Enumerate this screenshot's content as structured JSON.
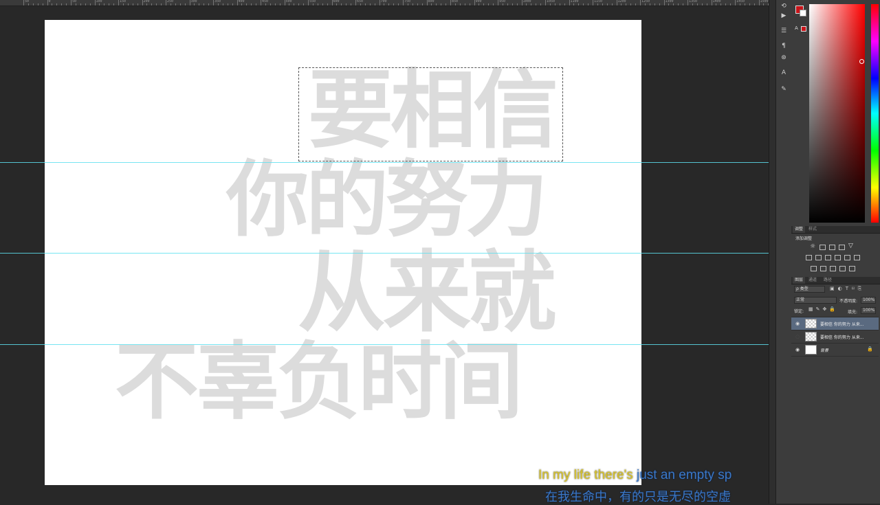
{
  "ruler": {
    "labels": [
      "50",
      "0",
      "50",
      "100",
      "150",
      "200",
      "250",
      "300",
      "350",
      "400",
      "450",
      "500",
      "550",
      "600",
      "650",
      "700",
      "750",
      "800",
      "850",
      "900",
      "950",
      "1000",
      "1050",
      "1100",
      "1150",
      "1200",
      "1250",
      "1300",
      "1350",
      "1400",
      "1450",
      "1500"
    ]
  },
  "canvas": {
    "lines": [
      "要相信",
      "你的努力",
      "从来就",
      "不辜负时间"
    ],
    "text_color": "#dcdcdc",
    "background": "#ffffff"
  },
  "subtitle": {
    "en_highlight": "In my life there's",
    "en_rest": " just an empty sp",
    "zh": "在我生命中，有的只是无尽的空虚"
  },
  "toolstrip": {
    "icons": [
      "history-icon",
      "play-icon",
      "sliders-icon",
      "paragraph-icon",
      "clone-source-icon",
      "character-icon",
      "brush-presets-icon"
    ]
  },
  "colors": {
    "foreground": "#c8141a",
    "background": "#ffffff"
  },
  "adjustments_panel": {
    "tabs": [
      "调整",
      "样式"
    ],
    "title": "添加调整"
  },
  "layers_panel": {
    "tabs": [
      "图层",
      "通道",
      "路径"
    ],
    "filter_label": "ρ 类型",
    "blend_mode": "正常",
    "opacity_label": "不透明度:",
    "opacity_value": "100%",
    "lock_label": "锁定:",
    "fill_label": "填充:",
    "fill_value": "100%",
    "layers": [
      {
        "name": "要相信 你的努力 从来...",
        "selected": true,
        "visible": true,
        "thumb": "check"
      },
      {
        "name": "要相信 你的努力 从来...",
        "selected": false,
        "visible": false,
        "thumb": "check"
      },
      {
        "name": "背景",
        "selected": false,
        "visible": true,
        "thumb": "white",
        "locked": true
      }
    ]
  }
}
